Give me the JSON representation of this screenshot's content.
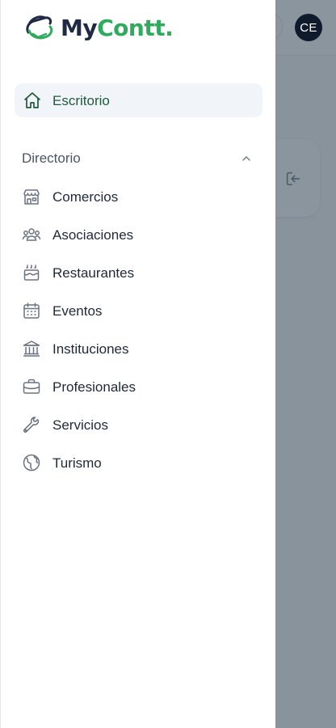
{
  "header": {
    "avatar_initials": "CE"
  },
  "drawer": {
    "logo": {
      "part1": "My",
      "part2": "Contt",
      "suffix": "."
    },
    "home_label": "Escritorio",
    "section_label": "Directorio",
    "items": [
      {
        "label": "Comercios",
        "icon": "store-icon"
      },
      {
        "label": "Asociaciones",
        "icon": "users-icon"
      },
      {
        "label": "Restaurantes",
        "icon": "cake-icon"
      },
      {
        "label": "Eventos",
        "icon": "calendar-icon"
      },
      {
        "label": "Instituciones",
        "icon": "building-columns-icon"
      },
      {
        "label": "Profesionales",
        "icon": "briefcase-icon"
      },
      {
        "label": "Servicios",
        "icon": "wrench-icon"
      },
      {
        "label": "Turismo",
        "icon": "globe-icon"
      }
    ]
  },
  "colors": {
    "brand_dark": "#1f2a44",
    "brand_green": "#2faa5e",
    "active_text": "#1f5a3a",
    "icon_gray": "#6b7280",
    "overlay": "#5a6875"
  }
}
